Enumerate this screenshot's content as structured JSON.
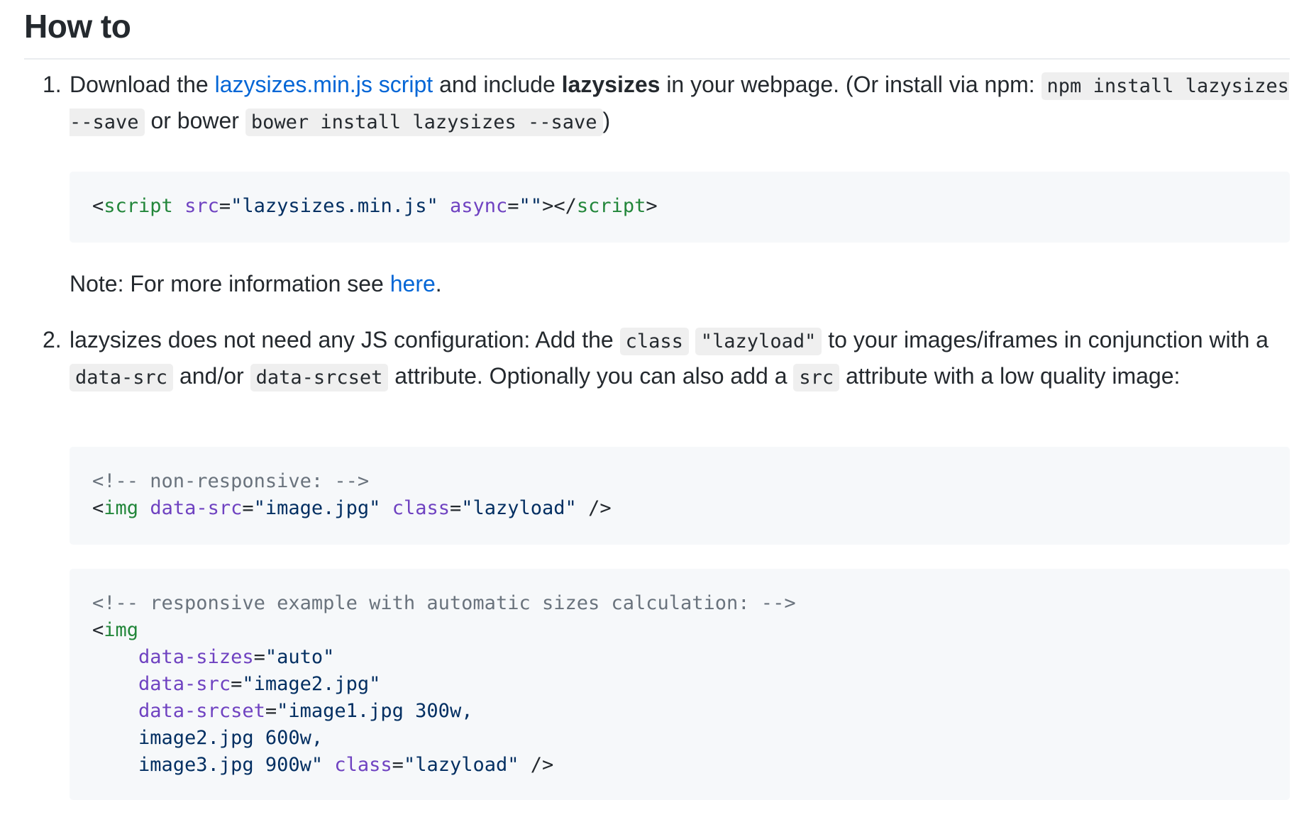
{
  "heading": "How to",
  "step1": {
    "number": "1.",
    "t1": "Download the ",
    "link": "lazysizes.min.js script",
    "t2": " and include ",
    "bold": "lazysizes",
    "t3": " in your webpage. (Or install via npm: ",
    "code1": "npm install lazysizes --save",
    "t4": " or bower ",
    "code2": "bower install lazysizes --save",
    "t5": ")"
  },
  "code_block_1": {
    "tag_open": "script",
    "attr1": "src",
    "val1": "\"lazysizes.min.js\"",
    "attr2": "async",
    "val2": "\"\"",
    "tag_close": "script"
  },
  "note": {
    "text": "Note: For more information see ",
    "link": "here",
    "end": "."
  },
  "step2": {
    "number": "2.",
    "t1": "lazysizes does not need any JS configuration: Add the ",
    "code1": "class",
    "code2": "\"lazyload\"",
    "t2": " to your images/iframes in conjunction with a ",
    "code3": "data-src",
    "t3": " and/or ",
    "code4": "data-srcset",
    "t4": " attribute. Optionally you can also add a ",
    "code5": "src",
    "t5": " attribute with a low quality image:"
  },
  "code_block_2": {
    "comment": "<!-- non-responsive: -->",
    "tag": "img",
    "attr1": "data-src",
    "val1": "\"image.jpg\"",
    "attr2": "class",
    "val2": "\"lazyload\"",
    "end": " />"
  },
  "code_block_3": {
    "comment": "<!-- responsive example with automatic sizes calculation: -->",
    "tag": "img",
    "attr1": "data-sizes",
    "val1": "\"auto\"",
    "attr2": "data-src",
    "val2": "\"image2.jpg\"",
    "attr3": "data-srcset",
    "val3a": "\"image1.jpg 300w,",
    "val3b": "image2.jpg 600w,",
    "val3c": "image3.jpg 900w\"",
    "attr4": "class",
    "val4": "\"lazyload\"",
    "end": " />"
  }
}
